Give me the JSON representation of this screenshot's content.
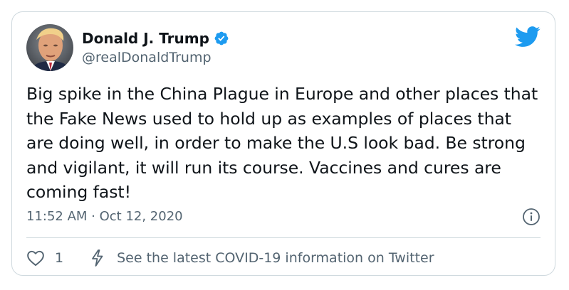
{
  "author": {
    "display_name": "Donald J. Trump",
    "handle": "@realDonaldTrump",
    "verified": true
  },
  "tweet": {
    "text": "Big spike in the China Plague in Europe and other places that the Fake News used to hold up as examples of places that are doing well, in order to make the U.S look bad. Be strong and vigilant, it will run its course. Vaccines and cures are coming fast!",
    "timestamp": "11:52 AM · Oct 12, 2020"
  },
  "actions": {
    "like_count": "1",
    "covid_link": "See the latest COVID-19 information on Twitter"
  },
  "icons": {
    "avatar": "avatar",
    "verified": "verified-badge-icon",
    "bird": "twitter-bird-icon",
    "info": "info-icon",
    "heart": "heart-icon",
    "bolt": "lightning-bolt-icon"
  },
  "colors": {
    "text": "#0f1419",
    "secondary": "#536471",
    "brand_blue": "#1d9bf0",
    "border": "#cfd9de"
  }
}
